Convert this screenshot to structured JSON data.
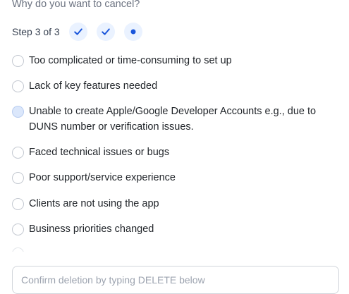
{
  "form": {
    "title": "Why do you want to cancel?",
    "step_label": "Step 3 of 3",
    "steps": [
      {
        "state": "complete",
        "icon": "check-icon"
      },
      {
        "state": "complete",
        "icon": "check-icon"
      },
      {
        "state": "current",
        "icon": "dot-icon"
      }
    ],
    "accent_color": "#1a56db",
    "reasons": [
      {
        "label": "Too complicated or time-consuming to set up"
      },
      {
        "label": "Lack of key features needed"
      },
      {
        "label": "Unable to create Apple/Google Developer Accounts e.g., due to DUNS number or verification issues.",
        "state": "hover"
      },
      {
        "label": "Faced technical issues or bugs"
      },
      {
        "label": "Poor support/service experience"
      },
      {
        "label": "Clients are not using the app"
      },
      {
        "label": "Business priorities changed"
      }
    ],
    "confirm": {
      "placeholder": "Confirm deletion by typing DELETE below",
      "value": ""
    }
  }
}
